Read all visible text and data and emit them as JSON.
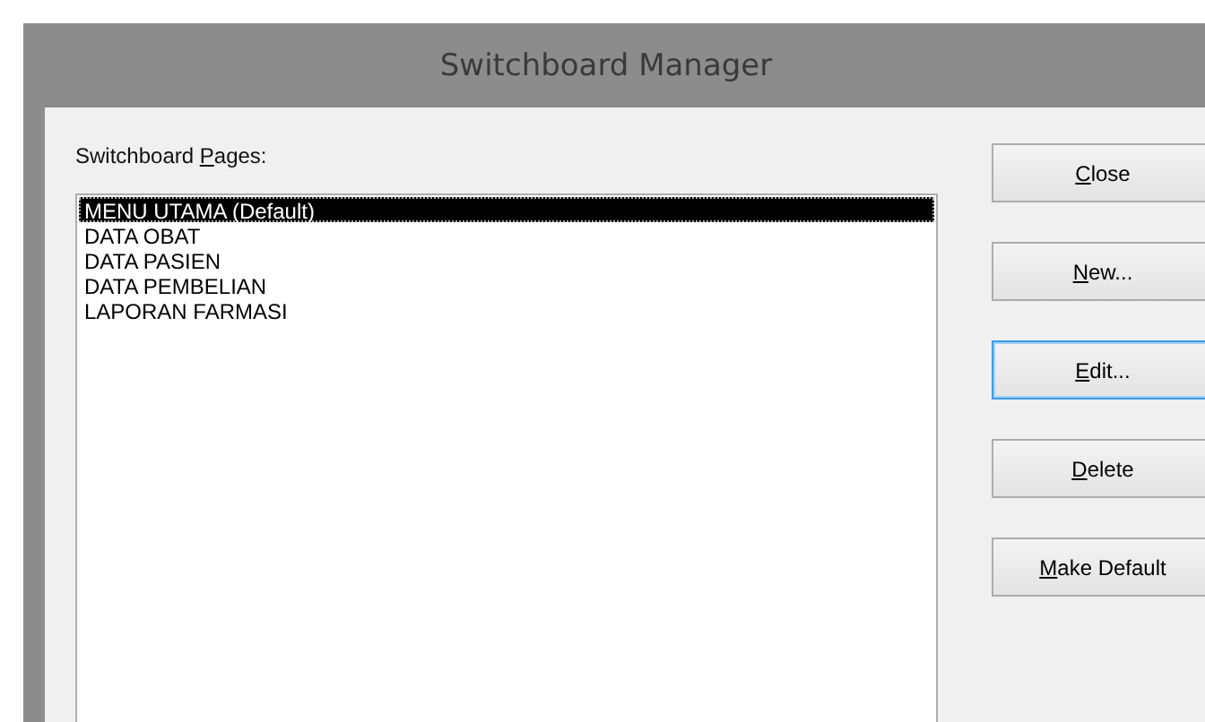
{
  "window": {
    "title": "Switchboard Manager"
  },
  "pages_label": {
    "pre": "Switchboard ",
    "key": "P",
    "post": "ages:"
  },
  "pages": [
    {
      "label": "MENU UTAMA (Default)",
      "selected": true
    },
    {
      "label": "DATA OBAT",
      "selected": false
    },
    {
      "label": "DATA PASIEN",
      "selected": false
    },
    {
      "label": "DATA PEMBELIAN",
      "selected": false
    },
    {
      "label": "LAPORAN FARMASI",
      "selected": false
    }
  ],
  "buttons": [
    {
      "key": "C",
      "post": "lose",
      "focused": false
    },
    {
      "key": "N",
      "post": "ew...",
      "focused": false
    },
    {
      "key": "E",
      "post": "dit...",
      "focused": true
    },
    {
      "key": "D",
      "post": "elete",
      "focused": false
    },
    {
      "key": "M",
      "post": "ake Default",
      "focused": false
    }
  ]
}
